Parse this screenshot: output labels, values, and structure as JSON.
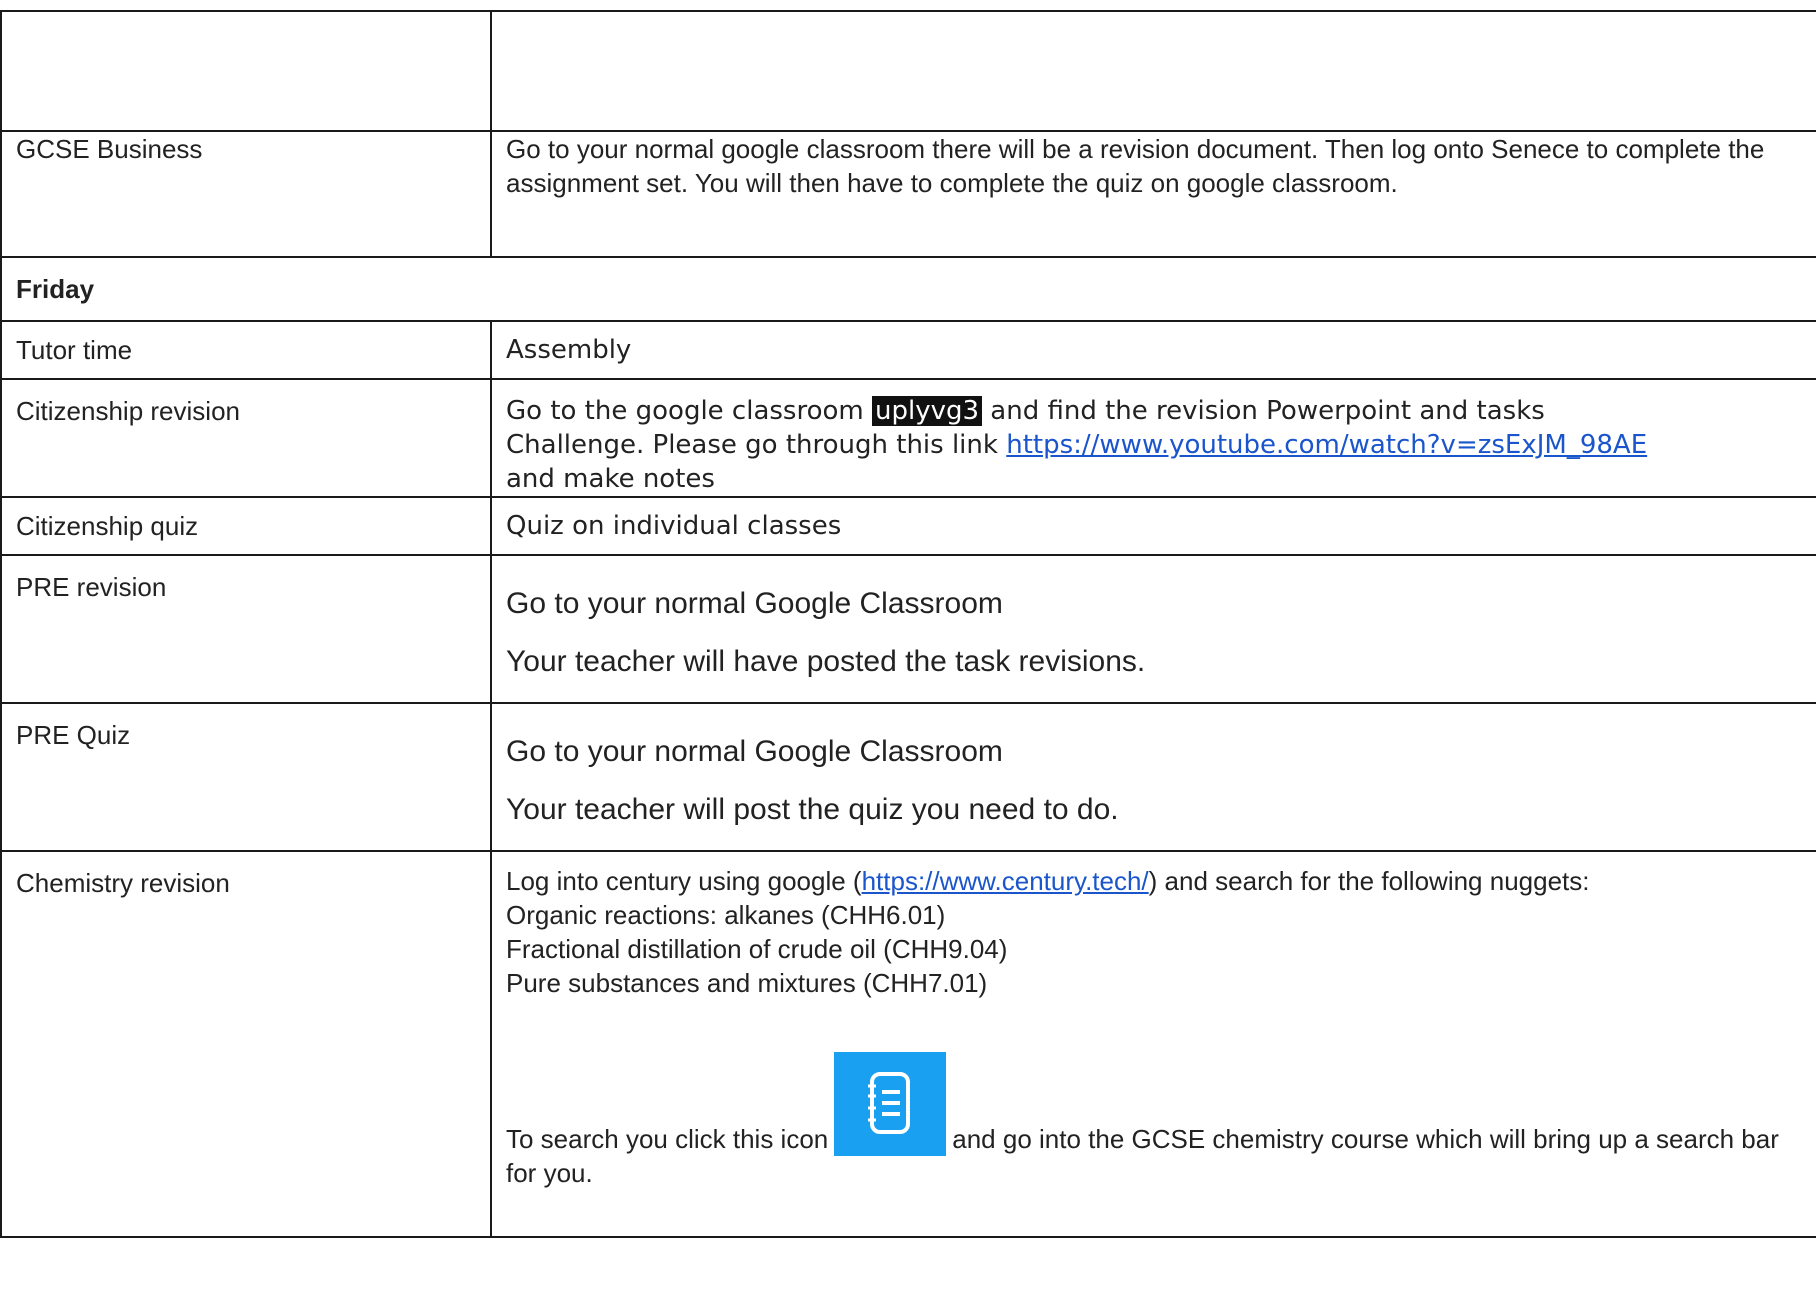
{
  "rows": {
    "business": {
      "subject": "GCSE Business",
      "task": "Go to your normal google classroom there will be a revision document. Then log onto Senece to complete the assignment set. You will then have to complete the quiz on google classroom."
    },
    "friday": {
      "label": "Friday"
    },
    "tutor": {
      "subject": "Tutor time",
      "task": "Assembly"
    },
    "citizenship_revision": {
      "subject": "Citizenship revision",
      "line1_before": "Go to the google classroom",
      "code": "uplyvg3",
      "line1_after": "and find the revision Powerpoint and tasks",
      "line2_before": "Challenge. Please go through this link",
      "link": "https://www.youtube.com/watch?v=zsExJM_98AE",
      "line3": "and make notes"
    },
    "citizenship_quiz": {
      "subject": "Citizenship quiz",
      "task": "Quiz on individual classes"
    },
    "pre_revision": {
      "subject": "PRE revision",
      "line1": "Go to your normal Google Classroom",
      "line2": "Your teacher will have posted the task revisions."
    },
    "pre_quiz": {
      "subject": "PRE Quiz",
      "line1": "Go to your normal Google Classroom",
      "line2": "Your teacher will post the quiz you need to do."
    },
    "chemistry": {
      "subject": "Chemistry revision",
      "intro_before": "Log into century using google (",
      "link": "https://www.century.tech/",
      "intro_after": ") and search for the following nuggets:",
      "nuggets": [
        "Organic reactions: alkanes (CHH6.01)",
        "Fractional distillation of crude oil (CHH9.04)",
        "Pure substances and mixtures (CHH7.01)"
      ],
      "search_before": "To search you click this icon",
      "search_after": "and go into the GCSE chemistry course which will bring up a search bar for you.",
      "icon": "notebook-list-icon",
      "icon_color": "#1aa0f0"
    }
  }
}
